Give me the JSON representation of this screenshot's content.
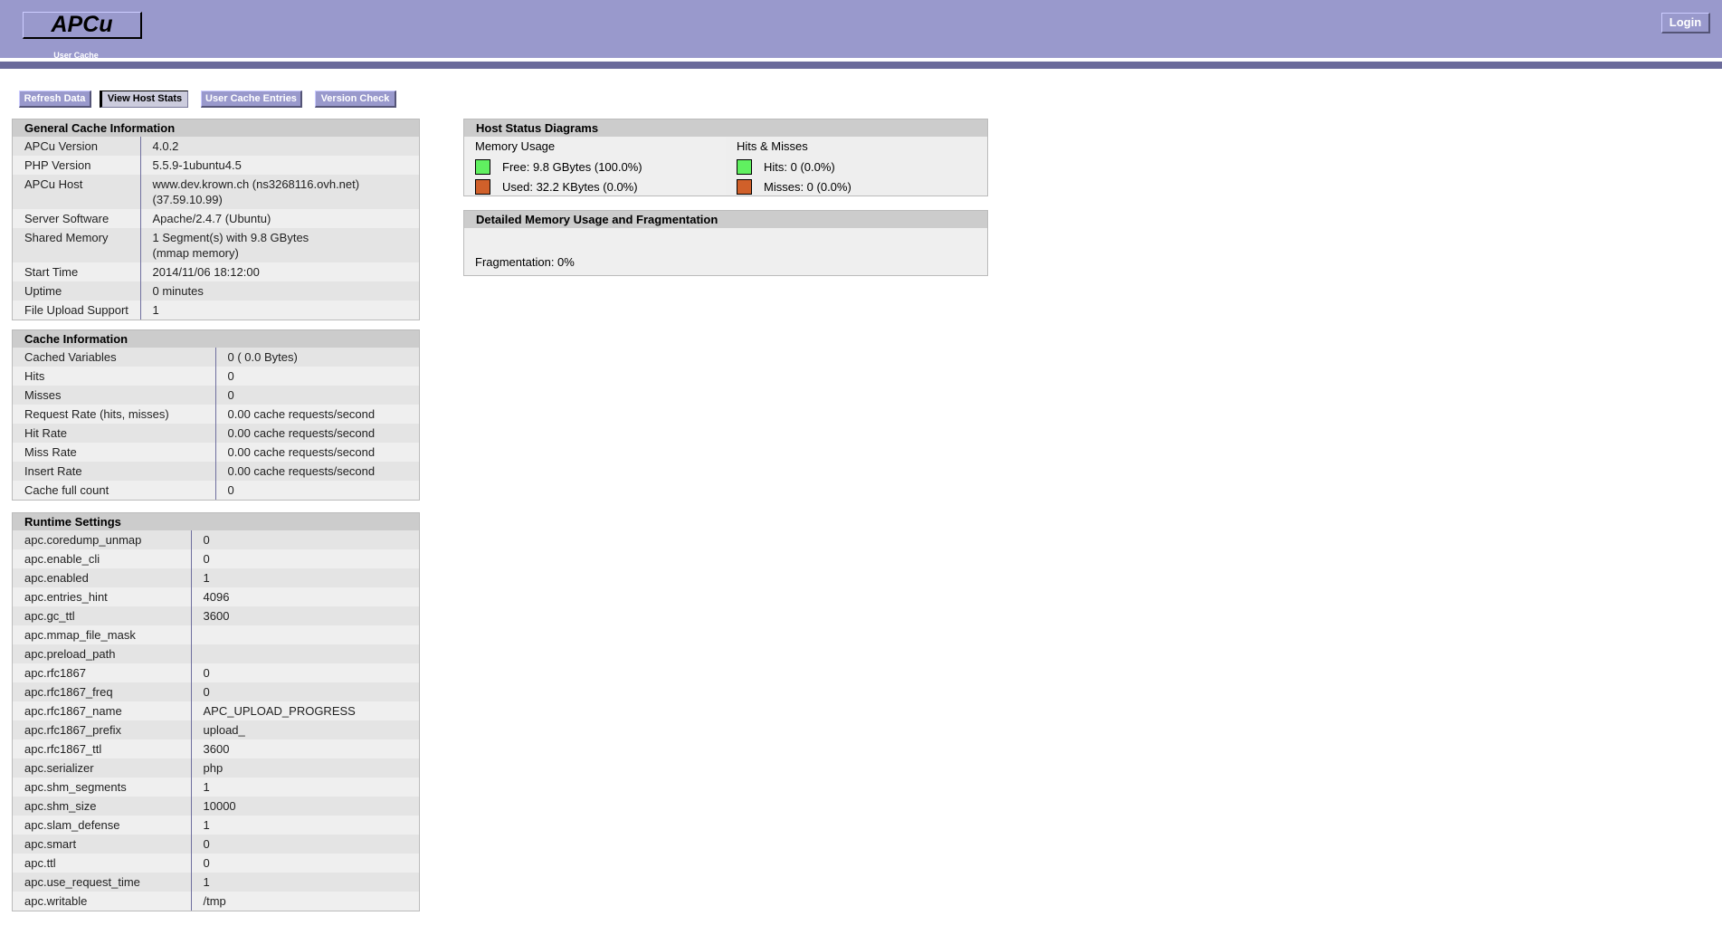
{
  "header": {
    "logo_title": "APCu",
    "logo_subtitle": "User Cache",
    "login_label": "Login"
  },
  "nav": [
    {
      "label": "Refresh Data",
      "active": false
    },
    {
      "label": "View Host Stats",
      "active": true
    },
    {
      "label": "User Cache Entries",
      "active": false
    },
    {
      "label": "Version Check",
      "active": false
    }
  ],
  "general": {
    "title": "General Cache Information",
    "rows": [
      {
        "key": "APCu Version",
        "value": "4.0.2"
      },
      {
        "key": "PHP Version",
        "value": "5.5.9-1ubuntu4.5"
      },
      {
        "key": "APCu Host",
        "value": "www.dev.krown.ch (ns3268116.ovh.net)",
        "value2": "(37.59.10.99)"
      },
      {
        "key": "Server Software",
        "value": "Apache/2.4.7 (Ubuntu)"
      },
      {
        "key": "Shared Memory",
        "value": "1 Segment(s) with 9.8 GBytes",
        "value2": "(mmap memory)"
      },
      {
        "key": "Start Time",
        "value": "2014/11/06 18:12:00"
      },
      {
        "key": "Uptime",
        "value": "0 minutes"
      },
      {
        "key": "File Upload Support",
        "value": "1"
      }
    ]
  },
  "cache": {
    "title": "Cache Information",
    "rows": [
      {
        "key": "Cached Variables",
        "value": "0 ( 0.0 Bytes)"
      },
      {
        "key": "Hits",
        "value": "0"
      },
      {
        "key": "Misses",
        "value": "0"
      },
      {
        "key": "Request Rate (hits, misses)",
        "value": "0.00 cache requests/second"
      },
      {
        "key": "Hit Rate",
        "value": "0.00 cache requests/second"
      },
      {
        "key": "Miss Rate",
        "value": "0.00 cache requests/second"
      },
      {
        "key": "Insert Rate",
        "value": "0.00 cache requests/second"
      },
      {
        "key": "Cache full count",
        "value": "0"
      }
    ]
  },
  "runtime": {
    "title": "Runtime Settings",
    "rows": [
      {
        "key": "apc.coredump_unmap",
        "value": "0"
      },
      {
        "key": "apc.enable_cli",
        "value": "0"
      },
      {
        "key": "apc.enabled",
        "value": "1"
      },
      {
        "key": "apc.entries_hint",
        "value": "4096"
      },
      {
        "key": "apc.gc_ttl",
        "value": "3600"
      },
      {
        "key": "apc.mmap_file_mask",
        "value": ""
      },
      {
        "key": "apc.preload_path",
        "value": ""
      },
      {
        "key": "apc.rfc1867",
        "value": "0"
      },
      {
        "key": "apc.rfc1867_freq",
        "value": "0"
      },
      {
        "key": "apc.rfc1867_name",
        "value": "APC_UPLOAD_PROGRESS"
      },
      {
        "key": "apc.rfc1867_prefix",
        "value": "upload_"
      },
      {
        "key": "apc.rfc1867_ttl",
        "value": "3600"
      },
      {
        "key": "apc.serializer",
        "value": "php"
      },
      {
        "key": "apc.shm_segments",
        "value": "1"
      },
      {
        "key": "apc.shm_size",
        "value": "10000"
      },
      {
        "key": "apc.slam_defense",
        "value": "1"
      },
      {
        "key": "apc.smart",
        "value": "0"
      },
      {
        "key": "apc.ttl",
        "value": "0"
      },
      {
        "key": "apc.use_request_time",
        "value": "1"
      },
      {
        "key": "apc.writable",
        "value": "/tmp"
      }
    ]
  },
  "host_status": {
    "title": "Host Status Diagrams",
    "memory": {
      "title": "Memory Usage",
      "free": "Free: 9.8 GBytes (100.0%)",
      "used": "Used: 32.2 KBytes (0.0%)"
    },
    "hits": {
      "title": "Hits & Misses",
      "hits": "Hits: 0 (0.0%)",
      "misses": "Misses: 0 (0.0%)"
    },
    "colors": {
      "free": "#60f060",
      "used": "#d0602a"
    }
  },
  "fragmentation": {
    "title": "Detailed Memory Usage and Fragmentation",
    "text": "Fragmentation: 0%"
  }
}
